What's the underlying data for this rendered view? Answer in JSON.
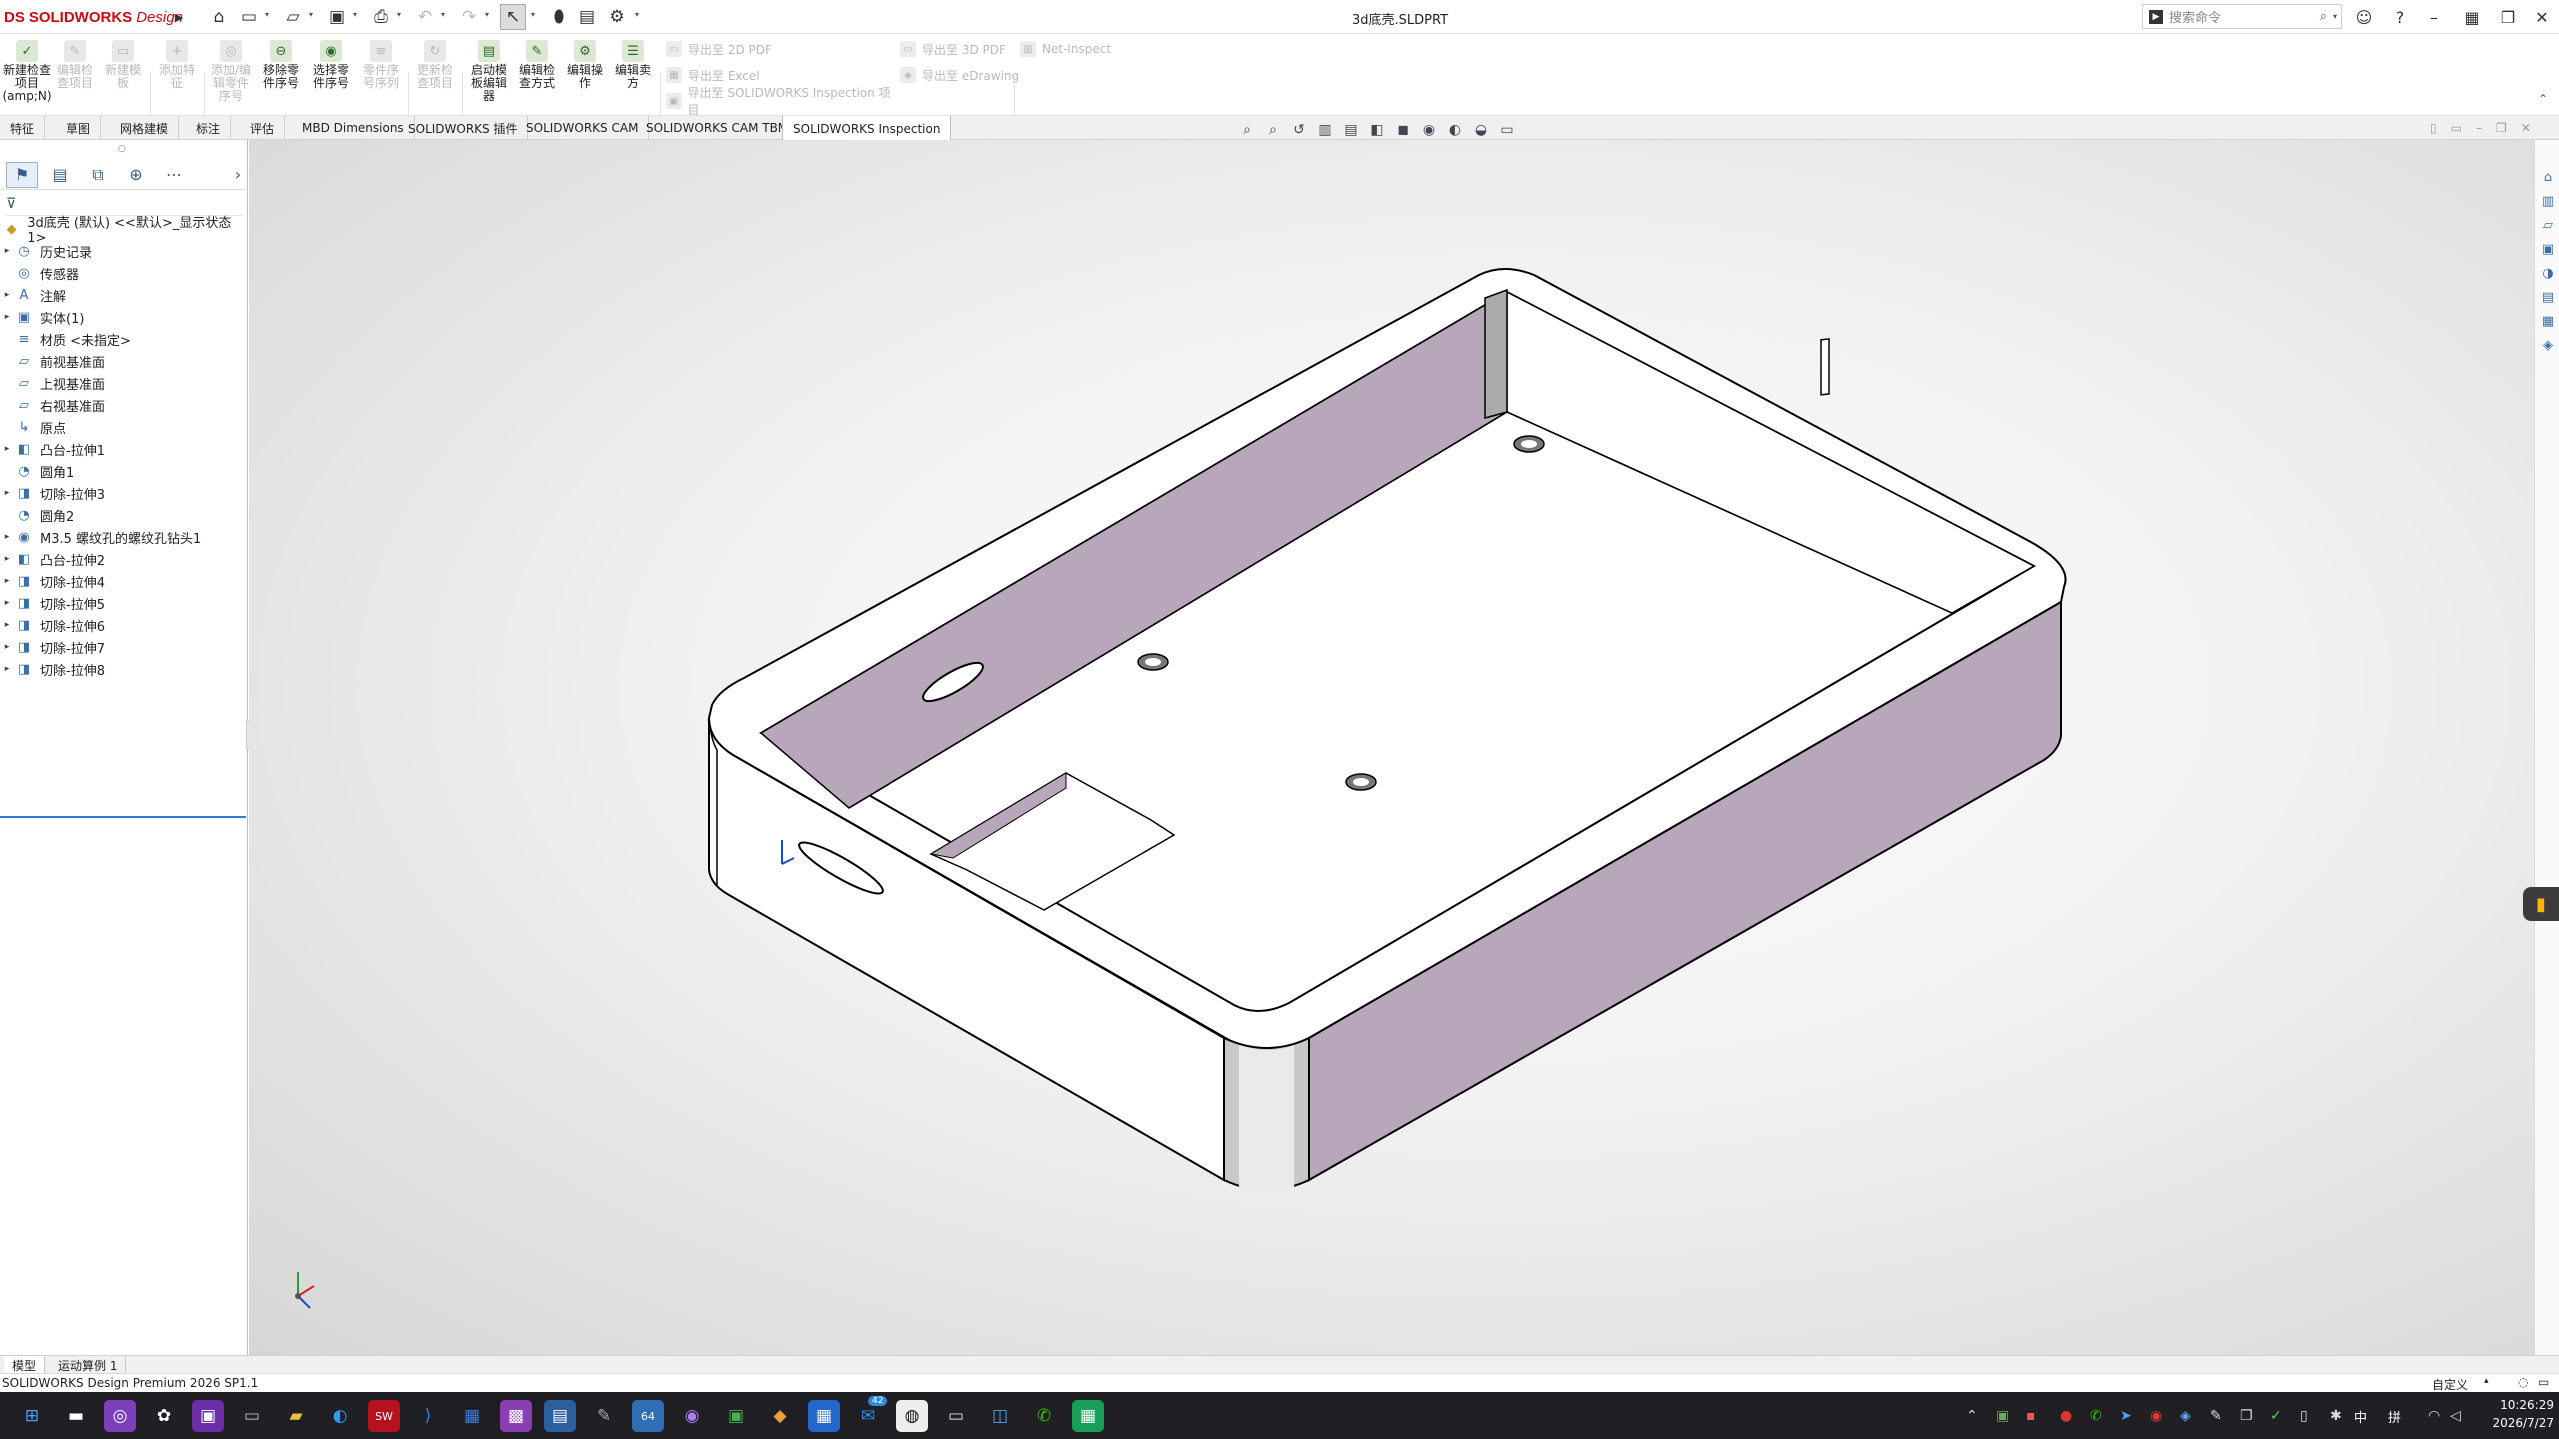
{
  "app": {
    "logo_ds": "DS",
    "logo_brand": "SOLIDWORKS",
    "logo_suffix": "Design",
    "document_title": "3d底壳.SLDPRT",
    "search_placeholder": "搜索命令"
  },
  "ribbon": {
    "big_buttons": [
      {
        "label": "新建检查项目(amp;N)",
        "enabled": true
      },
      {
        "label": "编辑检查项目",
        "enabled": false
      },
      {
        "label": "新建模板",
        "enabled": false
      },
      {
        "label": "添加特征",
        "enabled": false
      },
      {
        "label": "添加/编辑零件序号",
        "enabled": false
      },
      {
        "label": "移除零件序号",
        "enabled": true
      },
      {
        "label": "选择零件序号",
        "enabled": true
      },
      {
        "label": "零件序号序列",
        "enabled": false
      },
      {
        "label": "更新检查项目",
        "enabled": false
      },
      {
        "label": "启动模板编辑器",
        "enabled": true
      },
      {
        "label": "编辑检查方式",
        "enabled": true
      },
      {
        "label": "编辑操作",
        "enabled": true
      },
      {
        "label": "编辑卖方",
        "enabled": true
      }
    ],
    "export_2d_pdf": "导出至 2D PDF",
    "export_excel": "导出至 Excel",
    "export_sw_inspection": "导出至 SOLIDWORKS Inspection 项目",
    "export_3d_pdf": "导出至 3D PDF",
    "export_edrawing": "导出至 eDrawing",
    "net_inspect": "Net-Inspect"
  },
  "tabs": [
    "特征",
    "草图",
    "网格建模",
    "标注",
    "评估",
    "MBD Dimensions",
    "SOLIDWORKS 插件",
    "SOLIDWORKS CAM",
    "SOLIDWORKS CAM TBM",
    "SOLIDWORKS Inspection"
  ],
  "active_tab": "SOLIDWORKS Inspection",
  "tree": {
    "root": "3d底壳 (默认) <<默认>_显示状态 1>",
    "items": [
      {
        "label": "历史记录",
        "expandable": true,
        "icon": "history-icon"
      },
      {
        "label": "传感器",
        "expandable": false,
        "icon": "sensor-icon"
      },
      {
        "label": "注解",
        "expandable": true,
        "icon": "annotation-icon"
      },
      {
        "label": "实体(1)",
        "expandable": true,
        "icon": "solid-body-icon"
      },
      {
        "label": "材质 <未指定>",
        "expandable": false,
        "icon": "material-icon"
      },
      {
        "label": "前视基准面",
        "expandable": false,
        "icon": "plane-icon"
      },
      {
        "label": "上视基准面",
        "expandable": false,
        "icon": "plane-icon"
      },
      {
        "label": "右视基准面",
        "expandable": false,
        "icon": "plane-icon"
      },
      {
        "label": "原点",
        "expandable": false,
        "icon": "origin-icon"
      },
      {
        "label": "凸台-拉伸1",
        "expandable": true,
        "icon": "boss-extrude-icon"
      },
      {
        "label": "圆角1",
        "expandable": false,
        "icon": "fillet-icon"
      },
      {
        "label": "切除-拉伸3",
        "expandable": true,
        "icon": "cut-extrude-icon"
      },
      {
        "label": "圆角2",
        "expandable": false,
        "icon": "fillet-icon"
      },
      {
        "label": "M3.5 螺纹孔的螺纹孔钻头1",
        "expandable": true,
        "icon": "hole-wizard-icon"
      },
      {
        "label": "凸台-拉伸2",
        "expandable": true,
        "icon": "boss-extrude-icon"
      },
      {
        "label": "切除-拉伸4",
        "expandable": true,
        "icon": "cut-extrude-icon"
      },
      {
        "label": "切除-拉伸5",
        "expandable": true,
        "icon": "cut-extrude-icon"
      },
      {
        "label": "切除-拉伸6",
        "expandable": true,
        "icon": "cut-extrude-icon"
      },
      {
        "label": "切除-拉伸7",
        "expandable": true,
        "icon": "cut-extrude-icon"
      },
      {
        "label": "切除-拉伸8",
        "expandable": true,
        "icon": "cut-extrude-icon"
      }
    ]
  },
  "bottom_tabs": [
    "模型",
    "运动算例 1"
  ],
  "status": {
    "left": "SOLIDWORKS Design Premium 2026 SP1.1",
    "right": "自定义"
  },
  "taskbar": {
    "time": "10:26:29",
    "date": "2026/7/27",
    "ime": "中",
    "ime2": "拼",
    "badge": "42"
  },
  "colors": {
    "accent": "#2a7bd4",
    "brand": "#cc0a13",
    "part_inner_wall": "#b8a6bb",
    "part_face": "#ffffff"
  }
}
